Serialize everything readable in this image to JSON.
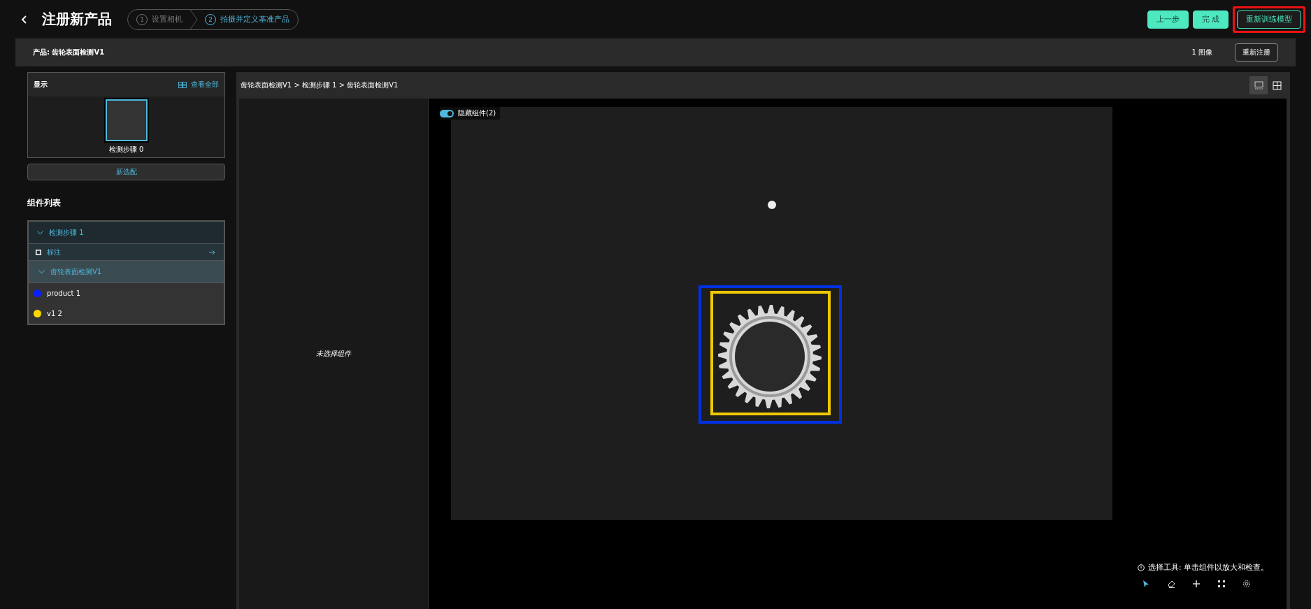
{
  "header": {
    "title": "注册新产品",
    "steps": [
      {
        "number": "1",
        "label": "设置相机",
        "selected": false
      },
      {
        "number": "2",
        "label": "拍摄并定义基准产品",
        "selected": true
      }
    ],
    "buttons": [
      {
        "label": "上一步",
        "kind": "filled",
        "highlighted": false
      },
      {
        "label": "完 成",
        "kind": "filled",
        "highlighted": false
      },
      {
        "label": "重新训练模型",
        "kind": "outline",
        "highlighted": true
      }
    ]
  },
  "product_bar": {
    "product": "产品: 齿轮表面检测V1",
    "image_count": "1 图像",
    "button": "重新注册"
  },
  "sidebar": {
    "display": {
      "title": "显示",
      "view_all": "查看全部",
      "thumbnails": [
        {
          "label": "检测步骤 0",
          "selected": true
        }
      ]
    },
    "new_button": "新选配",
    "components_title": "组件列表",
    "tree": [
      {
        "kind": "step",
        "label": "检测步骤 1",
        "expanded": true,
        "children": [
          {
            "kind": "tool",
            "label": "标注"
          },
          {
            "kind": "group",
            "label": "齿轮表面检测V1",
            "expanded": true,
            "children": [
              {
                "kind": "class",
                "label": "product 1",
                "color": "#0a1fff"
              },
              {
                "kind": "class",
                "label": "v1 2",
                "color": "#ffd800"
              }
            ]
          }
        ]
      }
    ]
  },
  "viewer": {
    "breadcrumb": "齿轮表面检测V1 > 检测步骤 1 > 齿轮表面检测V1",
    "view_modes": [
      {
        "kind": "single",
        "selected": true
      },
      {
        "kind": "grid",
        "selected": false
      }
    ],
    "empty_text": "未选择组件",
    "toggle": {
      "label": "隐藏组件(2)",
      "on": true
    },
    "boxes": [
      {
        "color": "#0030e0"
      },
      {
        "color": "#f0c800"
      }
    ],
    "hint": "选择工具: 单击组件以放大和检查。",
    "tools": [
      {
        "kind": "pointer",
        "selected": true
      },
      {
        "kind": "eraser",
        "selected": false
      },
      {
        "kind": "plus",
        "selected": false
      },
      {
        "kind": "fit",
        "selected": false
      },
      {
        "kind": "settings",
        "selected": false
      }
    ]
  }
}
